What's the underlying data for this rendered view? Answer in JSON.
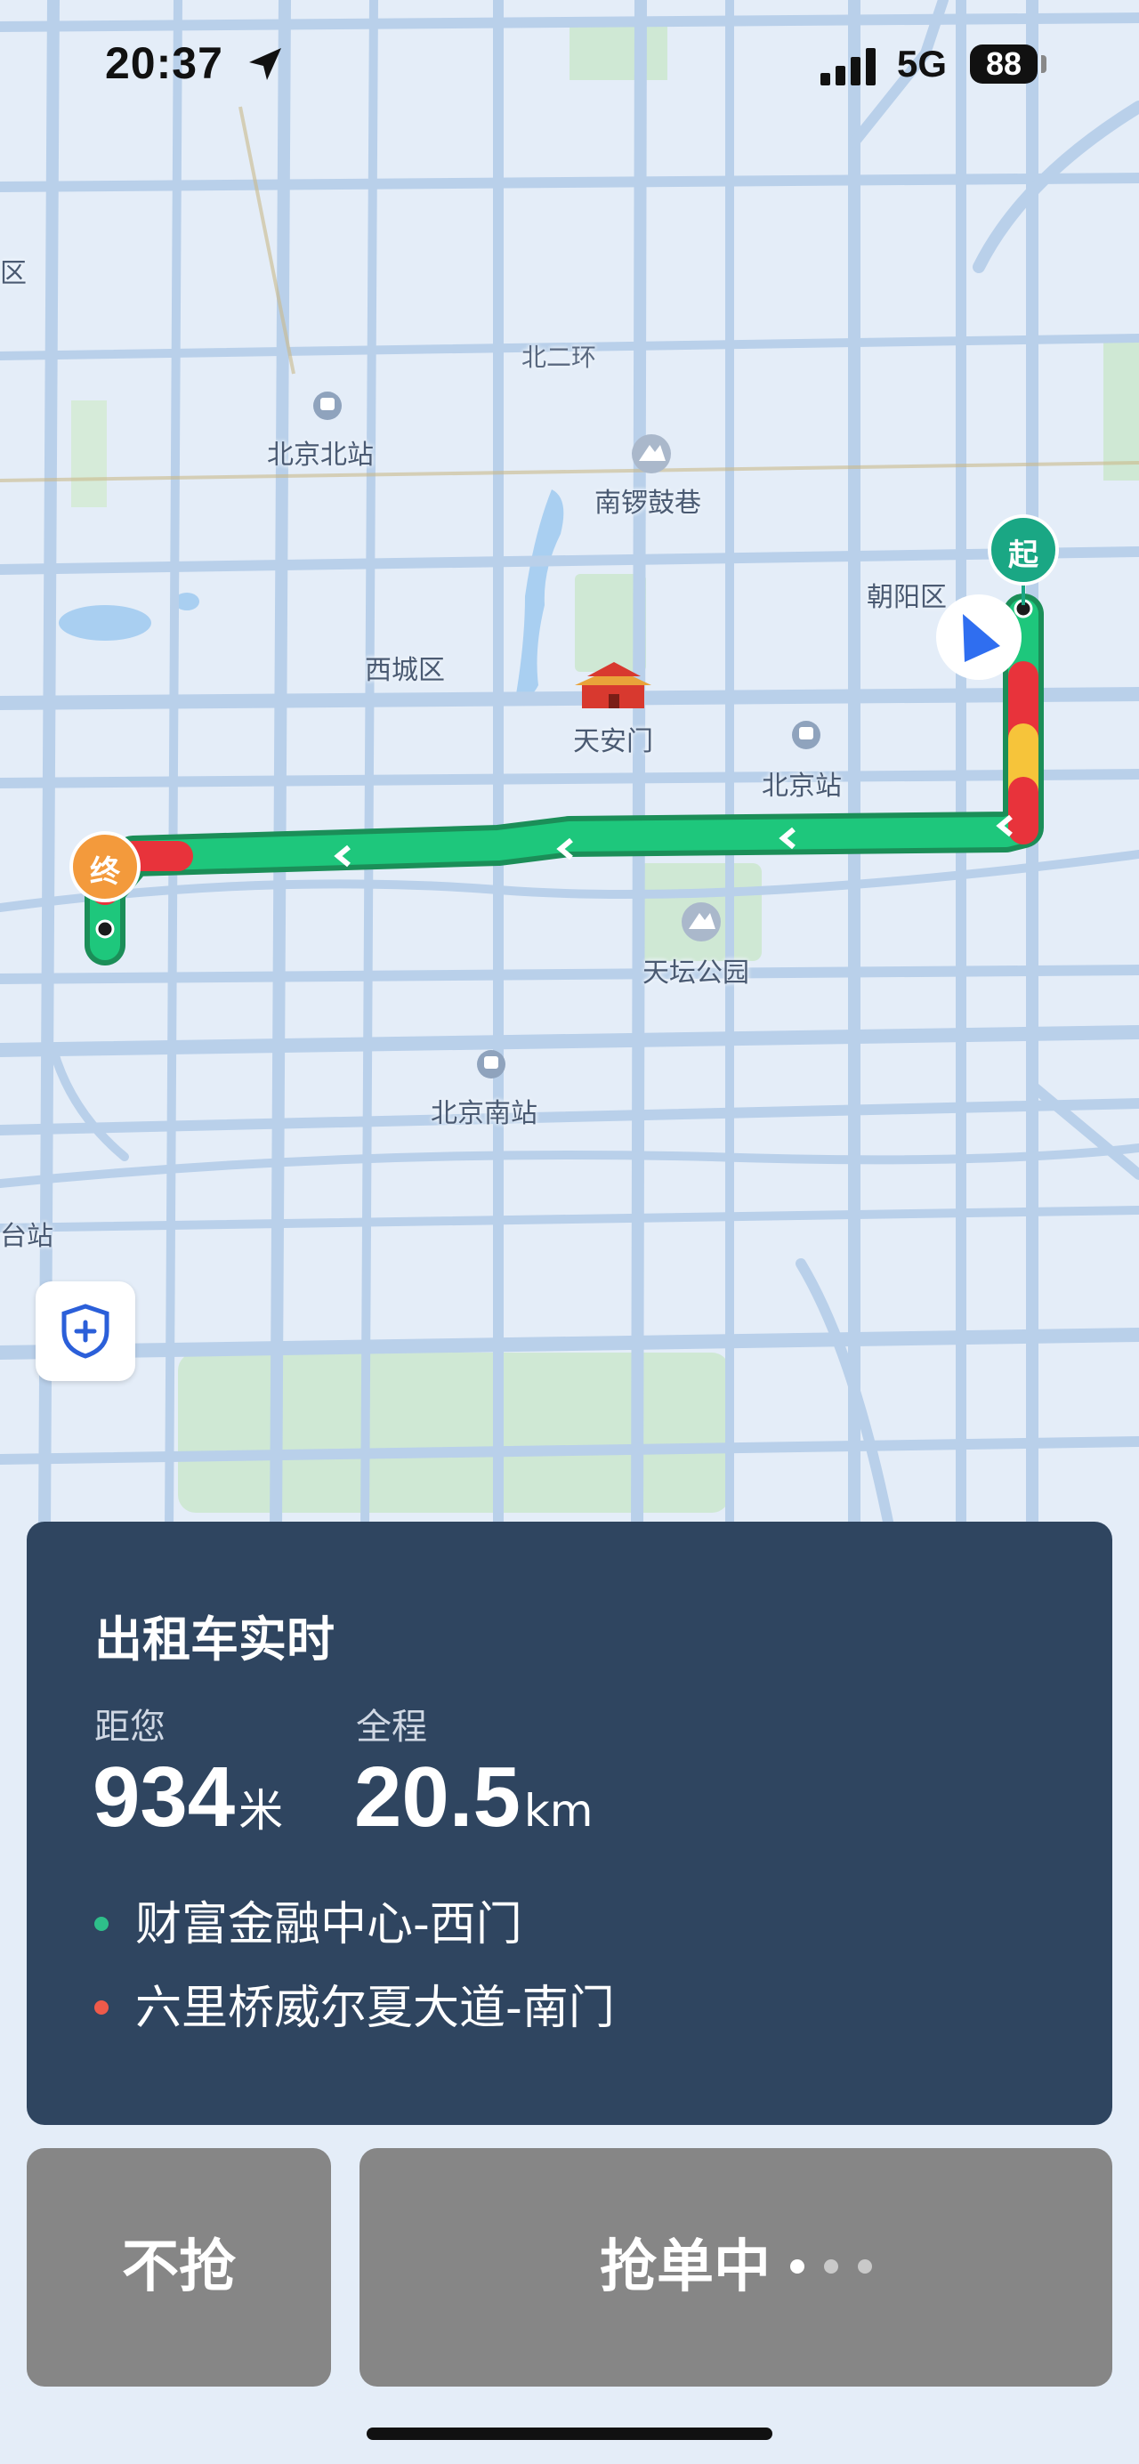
{
  "status_bar": {
    "time": "20:37",
    "network": "5G",
    "battery": "88"
  },
  "map": {
    "labels": [
      {
        "id": "beierhuan",
        "text": "北二环"
      },
      {
        "id": "beijing-north-station",
        "text": "北京北站"
      },
      {
        "id": "nanluoguxiang",
        "text": "南锣鼓巷"
      },
      {
        "id": "chaoyang-district",
        "text": "朝阳区"
      },
      {
        "id": "xicheng-district",
        "text": "西城区"
      },
      {
        "id": "tiananmen",
        "text": "天安门"
      },
      {
        "id": "beijing-station",
        "text": "北京站"
      },
      {
        "id": "temple-of-heaven",
        "text": "天坛公园"
      },
      {
        "id": "beijing-south-station",
        "text": "北京南站"
      },
      {
        "id": "west-edge-station",
        "text": "台站"
      },
      {
        "id": "west-edge-district",
        "text": "区"
      }
    ],
    "start_marker": "起",
    "end_marker": "终",
    "colors": {
      "route_green": "#1ec77c",
      "route_red": "#e8333b",
      "route_yellow": "#f6c43a",
      "start_teal": "#1aa784",
      "end_orange": "#f39a3c"
    }
  },
  "order": {
    "title": "出租车实时",
    "distance_label": "距您",
    "distance_value": "934",
    "distance_unit": "米",
    "total_label": "全程",
    "total_value": "20.5",
    "total_unit": "km",
    "pickup": "财富金融中心-西门",
    "dropoff": "六里桥威尔夏大道-南门",
    "pickup_color": "#2ebf8a",
    "dropoff_color": "#ef5a4a"
  },
  "actions": {
    "skip_label": "不抢",
    "grab_label": "抢单中"
  }
}
